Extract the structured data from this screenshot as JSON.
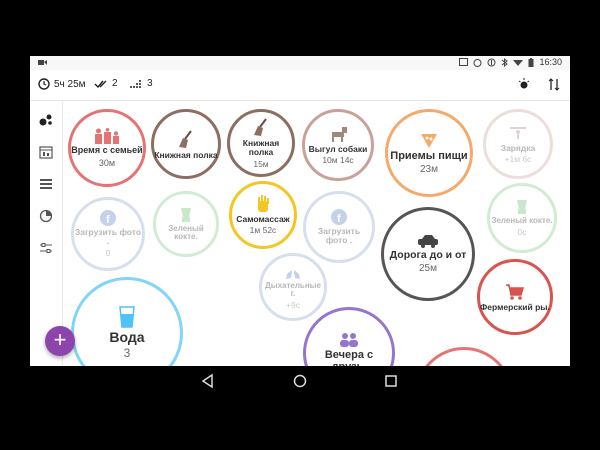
{
  "status_bar": {
    "left_icon": "camera-icon",
    "icons": [
      "screen-cast-icon",
      "alarm-icon",
      "battery-saver-icon",
      "bluetooth-icon",
      "wifi-icon",
      "battery-icon"
    ],
    "time": "16:30"
  },
  "toolbar": {
    "total_time": "5ч 25м",
    "completed_count": "2",
    "activities_count": "3",
    "right_icons": [
      "brightness-icon",
      "sort-icon"
    ]
  },
  "sidebar": {
    "items": [
      "bubbles-icon",
      "calendar-stats-icon",
      "list-icon",
      "pie-chart-icon",
      "settings-sliders-icon"
    ]
  },
  "activities": [
    {
      "name": "Время с семьей",
      "value": "30м",
      "icon": "family-icon",
      "color": "#e57373"
    },
    {
      "name": "Книжная полка",
      "value": "",
      "icon": "broom-icon",
      "color": "#8d6e63"
    },
    {
      "name": "Книжная полка",
      "value": "15м",
      "icon": "broom-icon",
      "color": "#8d6e63"
    },
    {
      "name": "Выгул собаки",
      "value": "10м 14с",
      "icon": "dog-icon",
      "color": "#c8a29a"
    },
    {
      "name": "Приемы пищи",
      "value": "23м",
      "icon": "pizza-icon",
      "color": "#f5a96b"
    },
    {
      "name": "Зарядка",
      "value": "+1м 6с",
      "icon": "exercise-icon",
      "color": "#c8a29a"
    },
    {
      "name": "Загрузить фото .",
      "value": "0",
      "icon": "facebook-icon",
      "color": "#90a4d4"
    },
    {
      "name": "Зеленый кокте.",
      "value": "",
      "icon": "blender-icon",
      "color": "#81c784"
    },
    {
      "name": "Самомассаж",
      "value": "1м 52с",
      "icon": "hand-icon",
      "color": "#f3c623"
    },
    {
      "name": "Загрузить фото .",
      "value": "",
      "icon": "facebook-icon",
      "color": "#90a4d4"
    },
    {
      "name": "Дорога до и от",
      "value": "25м",
      "icon": "car-icon",
      "color": "#555555"
    },
    {
      "name": "Зеленый кокте.",
      "value": "0с",
      "icon": "blender-icon",
      "color": "#81c784"
    },
    {
      "name": "Дыхательные г.",
      "value": "+9с",
      "icon": "lungs-icon",
      "color": "#90a4d4"
    },
    {
      "name": "Фермерский ры.",
      "value": "",
      "icon": "cart-icon",
      "color": "#d9534f"
    },
    {
      "name": "Вода",
      "value": "3",
      "icon": "glass-icon",
      "color": "#81d4fa"
    },
    {
      "name": "Вечера с друзь.",
      "value": "",
      "icon": "friends-icon",
      "color": "#9575cd"
    }
  ],
  "fab": {
    "label": "+"
  }
}
